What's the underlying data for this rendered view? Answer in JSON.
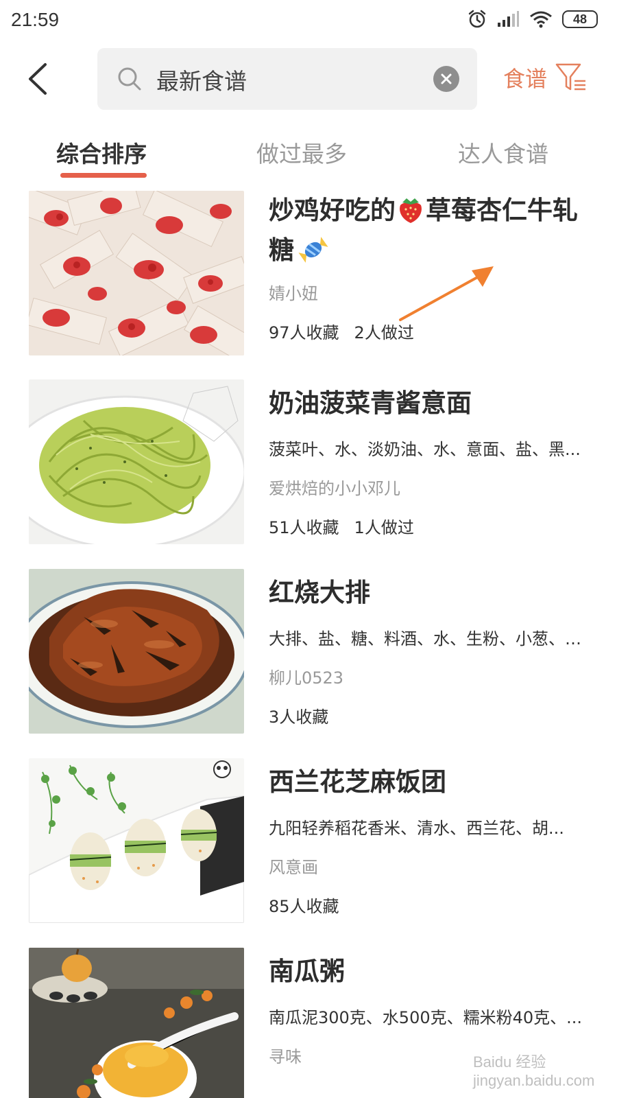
{
  "status_bar": {
    "time": "21:59",
    "battery": "48",
    "icons": [
      "alarm-icon",
      "signal-icon",
      "wifi-icon",
      "battery-icon"
    ]
  },
  "header": {
    "search_value": "最新食谱",
    "filter_label": "食谱"
  },
  "tabs": [
    {
      "label": "综合排序",
      "active": true
    },
    {
      "label": "做过最多",
      "active": false
    },
    {
      "label": "达人食谱",
      "active": false
    }
  ],
  "recipes": [
    {
      "title_part1": "炒鸡好吃的",
      "title_part2": "草莓杏仁牛轧糖",
      "ingredients": "",
      "author": "婧小妞",
      "favorites": "97人收藏",
      "made": "2人做过"
    },
    {
      "title_part1": "奶油菠菜青酱意面",
      "ingredients": "菠菜叶、水、淡奶油、水、意面、盐、黑...",
      "author": "爱烘焙的小小邓儿",
      "favorites": "51人收藏",
      "made": "1人做过"
    },
    {
      "title_part1": "红烧大排",
      "ingredients": "大排、盐、糖、料酒、水、生粉、小葱、老...",
      "author": "柳儿0523",
      "favorites": "3人收藏",
      "made": ""
    },
    {
      "title_part1": "西兰花芝麻饭团",
      "ingredients": "九阳轻养稻花香米、清水、西兰花、胡...",
      "author": "风意画",
      "favorites": "85人收藏",
      "made": ""
    },
    {
      "title_part1": "南瓜粥",
      "ingredients": "南瓜泥300克、水500克、糯米粉40克、...",
      "author": "寻味",
      "favorites": "",
      "made": ""
    }
  ],
  "watermark": "Baidu 经验 jingyan.baidu.com",
  "colors": {
    "accent": "#e4805d",
    "tab_underline": "#e5604a",
    "annotation_arrow": "#f08030"
  }
}
